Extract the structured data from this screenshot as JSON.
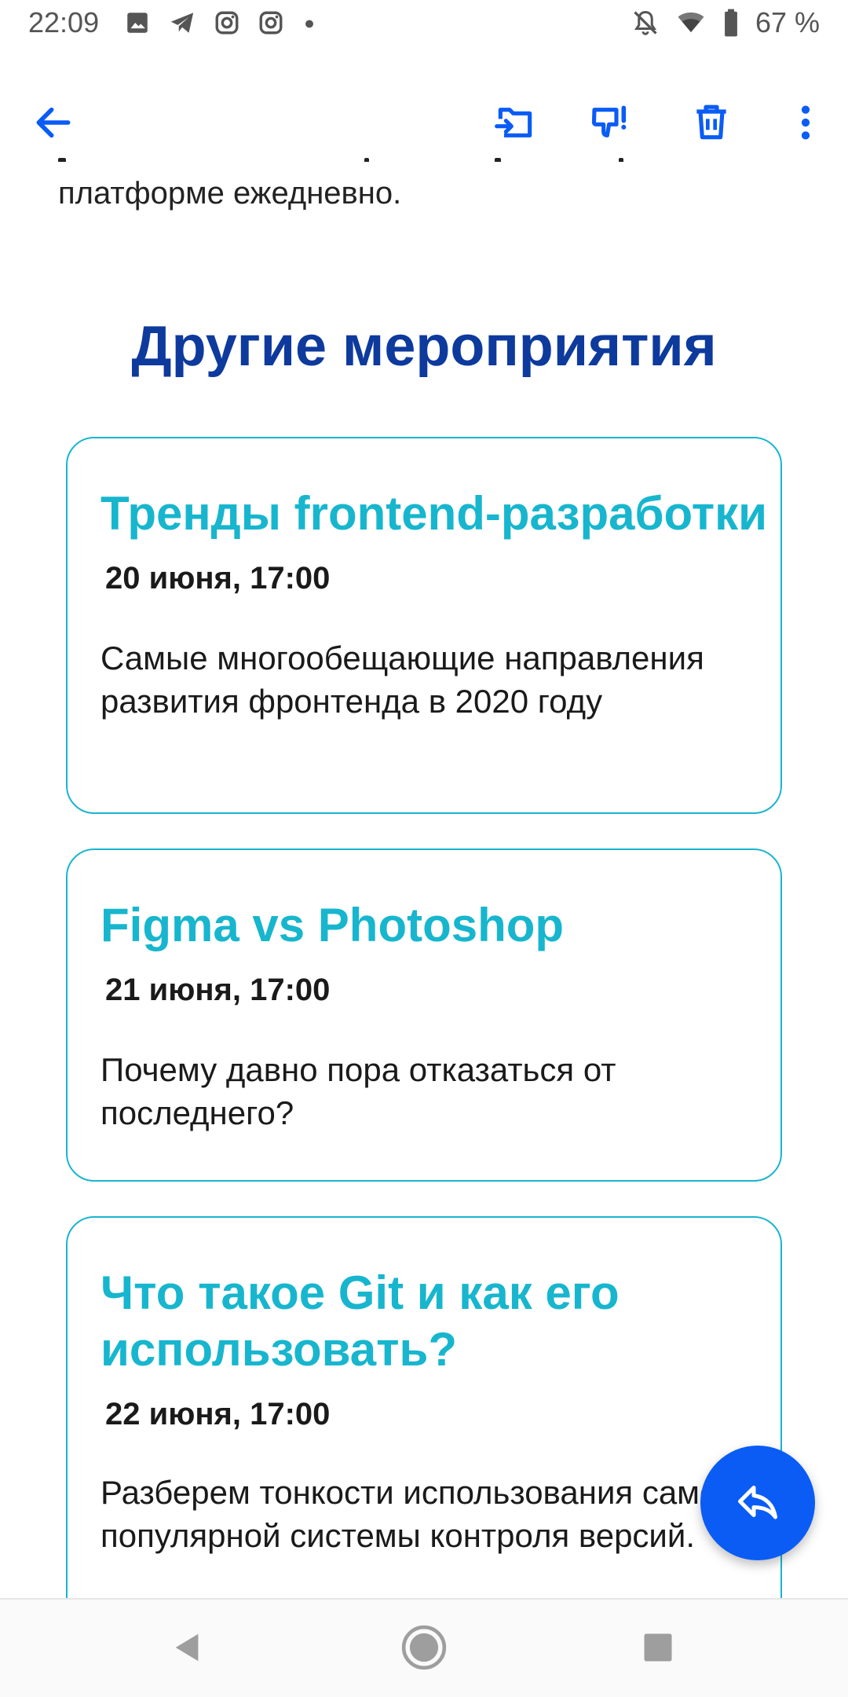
{
  "status_bar": {
    "time": "22:09",
    "left_icons": [
      "gallery-icon",
      "telegram-icon",
      "instagram-icon",
      "instagram-icon",
      "dot-icon"
    ],
    "right_icons": [
      "bell-off-icon",
      "wifi-icon",
      "battery-icon"
    ],
    "battery_text": "67 %"
  },
  "app_bar": {
    "icons": [
      "back-arrow-icon",
      "move-to-folder-icon",
      "spam-icon",
      "trash-icon",
      "more-vert-icon"
    ]
  },
  "content": {
    "prev_text": "платформе ежедневно.",
    "section_title": "Другие мероприятия",
    "events": [
      {
        "title": "Тренды frontend-разработки",
        "date": "20 июня, 17:00",
        "description": "Самые многообещающие направления развития фронтенда в 2020 году"
      },
      {
        "title": "Figma vs Photoshop",
        "date": "21 июня, 17:00",
        "description": "Почему давно пора отказаться от последнего?"
      },
      {
        "title": "Что такое Git и как его использовать?",
        "date": "22 июня, 17:00",
        "description": "Разберем тонкости использования самой популярной системы контроля версий."
      }
    ]
  },
  "colors": {
    "accent_blue": "#0a5cf5",
    "heading_blue": "#0d3a9c",
    "card_teal": "#17b6ce"
  },
  "fab": {
    "icon": "reply-icon"
  },
  "nav_bar": {
    "icons": [
      "nav-back-icon",
      "nav-home-icon",
      "nav-recents-icon"
    ]
  }
}
